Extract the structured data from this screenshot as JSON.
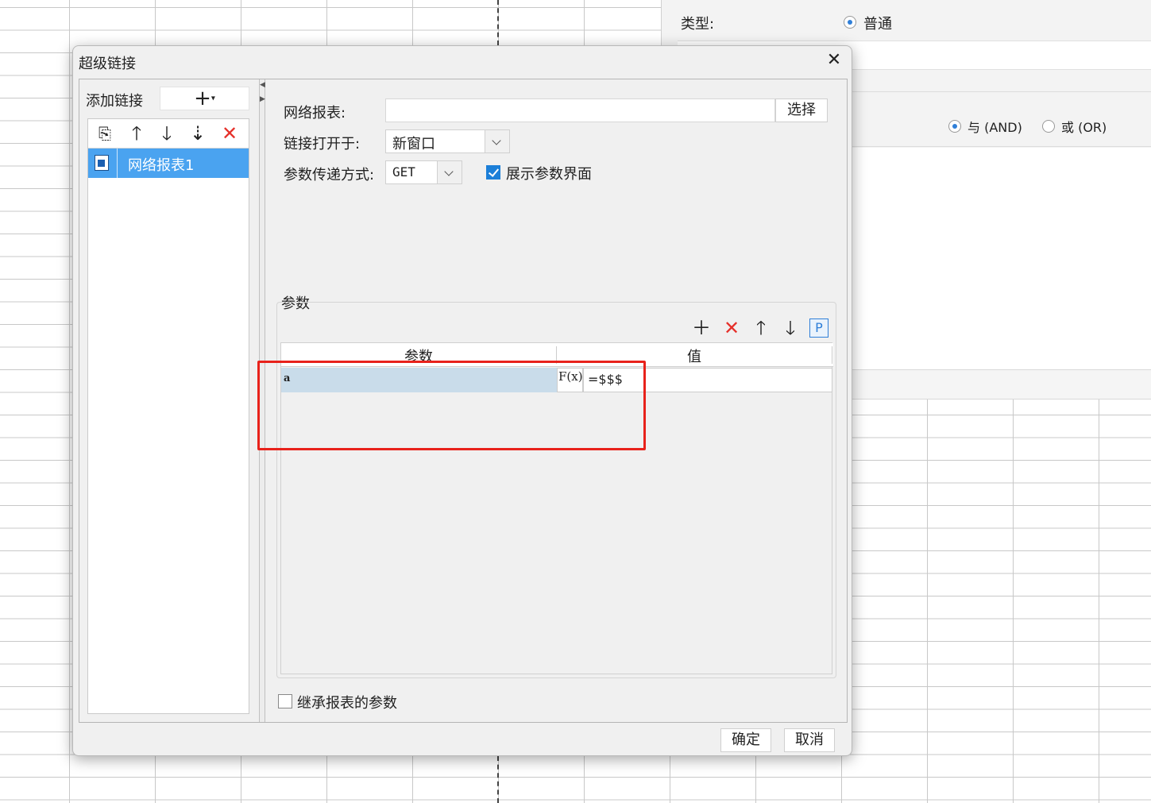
{
  "background_panel": {
    "type_label": "类型:",
    "type_value": "普通",
    "radio_and": "与 (AND)",
    "radio_or": "或 (OR)"
  },
  "dialog": {
    "title": "超级链接",
    "left": {
      "add_link_label": "添加链接",
      "add_button": "+",
      "items": [
        "网络报表1"
      ]
    },
    "form": {
      "web_report_label": "网络报表:",
      "web_report_value": "",
      "select_button": "选择",
      "open_in_label": "链接打开于:",
      "open_in_value": "新窗口",
      "param_method_label": "参数传递方式:",
      "param_method_value": "GET",
      "show_param_ui_label": "展示参数界面",
      "show_param_ui_checked": true
    },
    "params": {
      "group_label": "参数",
      "col_param": "参数",
      "col_value": "值",
      "rows": [
        {
          "name": "a",
          "formula_icon": "F(x)",
          "value": "=$$$"
        }
      ]
    },
    "inherit_label": "继承报表的参数",
    "inherit_checked": false,
    "ok_button": "确定",
    "cancel_button": "取消"
  },
  "colors": {
    "selection": "#4aa3f0",
    "highlight": "#e8221b",
    "param_row": "#c9dcea"
  }
}
